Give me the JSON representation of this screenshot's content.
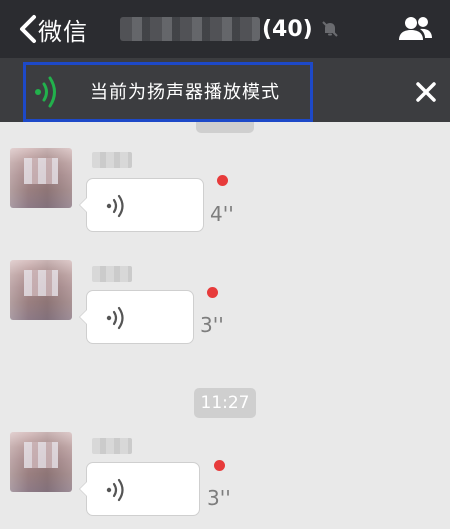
{
  "navbar": {
    "back_label": "微信",
    "title_count": "(40)",
    "icons": {
      "back": "chevron-left-icon",
      "mute": "muted-bell-icon",
      "members": "people-icon"
    }
  },
  "banner": {
    "text": "当前为扬声器播放模式",
    "icons": {
      "speaker": "speaker-icon",
      "close": "close-icon"
    },
    "colors": {
      "speaker": "#22b14c",
      "highlight_frame": "#1d49c8"
    }
  },
  "timestamp": "11:27",
  "messages": [
    {
      "type": "voice",
      "duration": "4''",
      "unread": true
    },
    {
      "type": "voice",
      "duration": "3''",
      "unread": true
    },
    {
      "type": "voice",
      "duration": "3''",
      "unread": true
    }
  ],
  "colors": {
    "navbar_bg": "#2b2c30",
    "chat_bg": "#e9e9e9",
    "unread_dot": "#e73b3b"
  }
}
